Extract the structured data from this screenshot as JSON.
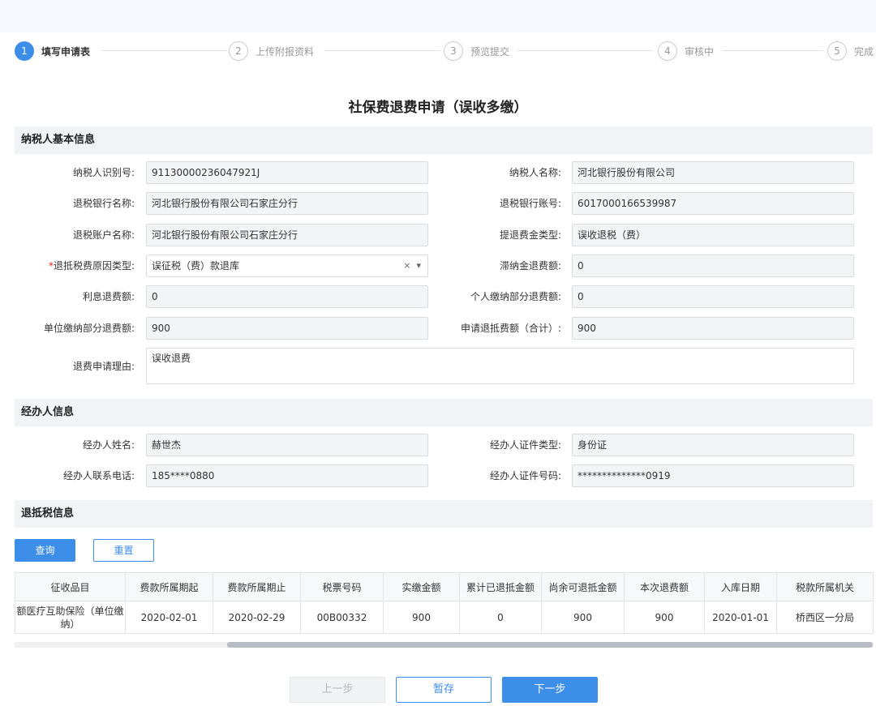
{
  "steps": [
    {
      "num": "1",
      "label": "填写申请表"
    },
    {
      "num": "2",
      "label": "上传附报资料"
    },
    {
      "num": "3",
      "label": "预览提交"
    },
    {
      "num": "4",
      "label": "审核中"
    },
    {
      "num": "5",
      "label": "完成"
    }
  ],
  "active_step": 1,
  "page_title": "社保费退费申请（误收多缴）",
  "sections": {
    "taxpayer": "纳税人基本信息",
    "agent": "经办人信息",
    "refund": "退抵税信息"
  },
  "taxpayer_fields": {
    "id_label": "纳税人识别号:",
    "id_value": "91130000236047921J",
    "name_label": "纳税人名称:",
    "name_value": "河北银行股份有限公司",
    "bank_label": "退税银行名称:",
    "bank_value": "河北银行股份有限公司石家庄分行",
    "account_label": "退税银行账号:",
    "account_value": "6017000166539987",
    "account_name_label": "退税账户名称:",
    "account_name_value": "河北银行股份有限公司石家庄分行",
    "type_label": "提退费金类型:",
    "type_value": "误收退税（费）",
    "reason_type_required": "*",
    "reason_type_label": "退抵税费原因类型:",
    "reason_type_value": "误征税（费）款退库",
    "late_fee_label": "滞纳金退费额:",
    "late_fee_value": "0",
    "interest_label": "利息退费额:",
    "interest_value": "0",
    "personal_label": "个人缴纳部分退费额:",
    "personal_value": "0",
    "unit_label": "单位缴纳部分退费额:",
    "unit_value": "900",
    "total_label": "申请退抵费额（合计）:",
    "total_value": "900",
    "reason_label": "退费申请理由:",
    "reason_value": "误收退费"
  },
  "agent_fields": {
    "name_label": "经办人姓名:",
    "name_value": "赫世杰",
    "cert_type_label": "经办人证件类型:",
    "cert_type_value": "身份证",
    "phone_label": "经办人联系电话:",
    "phone_value": "185****0880",
    "cert_no_label": "经办人证件号码:",
    "cert_no_value": "**************0919"
  },
  "refund_buttons": {
    "query": "查询",
    "reset": "重置"
  },
  "table": {
    "headers": [
      "征收品目",
      "费款所属期起",
      "费款所属期止",
      "税票号码",
      "实缴金额",
      "累计已退抵金额",
      "尚余可退抵金额",
      "本次退费额",
      "入库日期",
      "税款所属机关"
    ],
    "rows": [
      [
        "额医疗互助保险（单位缴纳）",
        "2020-02-01",
        "2020-02-29",
        "00B00332",
        "900",
        "0",
        "900",
        "900",
        "2020-01-01",
        "桥西区一分局"
      ]
    ]
  },
  "footer": {
    "prev": "上一步",
    "save": "暂存",
    "next": "下一步"
  },
  "colors": {
    "primary": "#3d8ee8",
    "required": "#e0241b",
    "section_bg": "#f1f3f6"
  }
}
